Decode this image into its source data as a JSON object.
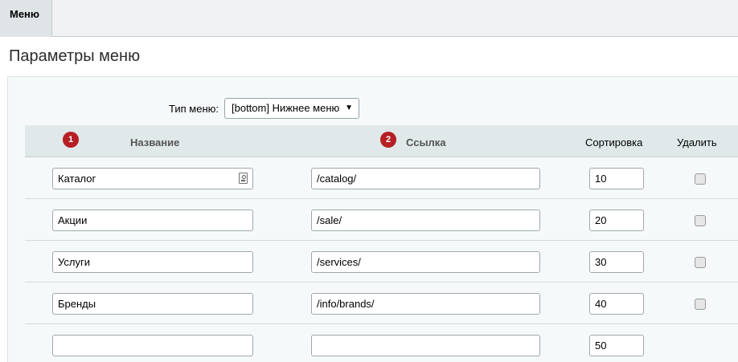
{
  "tabs": [
    {
      "label": "Меню"
    }
  ],
  "page_title": "Параметры меню",
  "menu_type": {
    "label": "Тип меню:",
    "selected": "[bottom] Нижнее меню"
  },
  "table": {
    "columns": {
      "name": {
        "badge": "1",
        "label": "Название"
      },
      "link": {
        "badge": "2",
        "label": "Ссылка"
      },
      "sort": {
        "label": "Сортировка"
      },
      "delete": {
        "label": "Удалить"
      }
    },
    "rows": [
      {
        "name": "Каталог",
        "link": "/catalog/",
        "sort": "10",
        "delete": false
      },
      {
        "name": "Акции",
        "link": "/sale/",
        "sort": "20",
        "delete": false
      },
      {
        "name": "Услуги",
        "link": "/services/",
        "sort": "30",
        "delete": false
      },
      {
        "name": "Бренды",
        "link": "/info/brands/",
        "sort": "40",
        "delete": false
      },
      {
        "name": "",
        "link": "",
        "sort": "50"
      }
    ]
  },
  "colors": {
    "accent_badge": "#b61f24",
    "header_bg": "#e0e8ea",
    "panel_bg": "#f5f9f9"
  }
}
